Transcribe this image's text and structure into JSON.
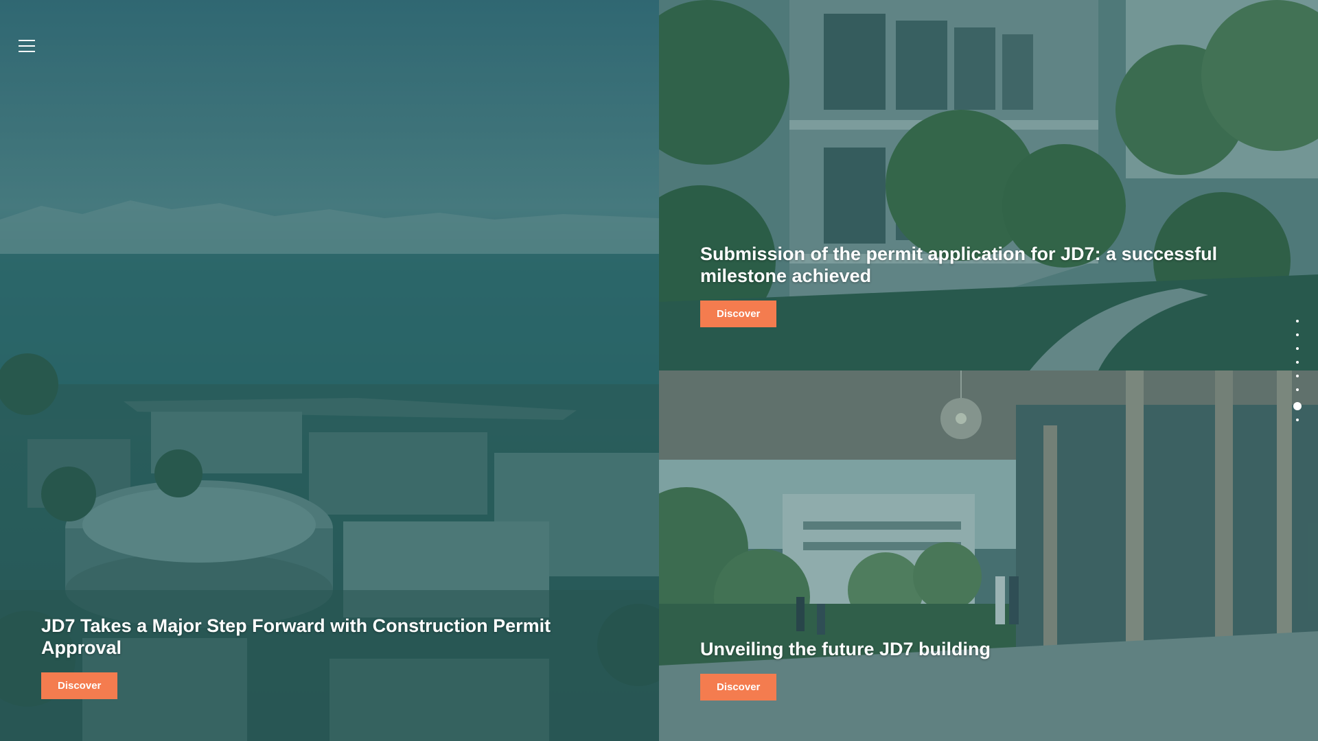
{
  "menu": {
    "icon": "hamburger-menu-icon"
  },
  "cards": [
    {
      "title": "JD7 Takes a Major Step Forward with Construction Permit Approval",
      "button": "Discover",
      "image": "aerial-city-lake-view"
    },
    {
      "title": "Submission of the permit application for JD7: a successful milestone achieved",
      "button": "Discover",
      "image": "curved-building-garden-path"
    },
    {
      "title": "Unveiling the future JD7 building",
      "button": "Discover",
      "image": "building-entrance-terrace"
    }
  ],
  "pagination": {
    "total": 8,
    "active_index": 6
  },
  "colors": {
    "accent": "#f47c4f",
    "overlay": "#1e585c",
    "text": "#ffffff"
  }
}
